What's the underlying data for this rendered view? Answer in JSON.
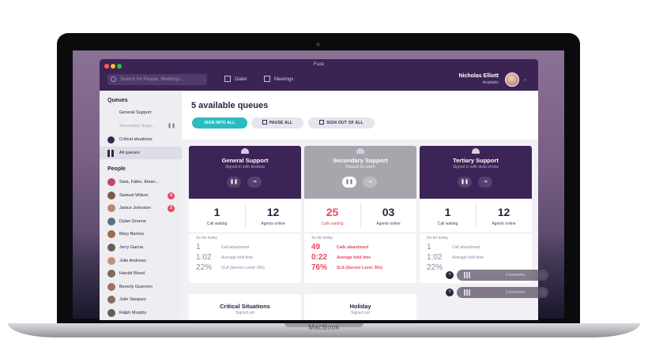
{
  "app": {
    "title": "Fuze",
    "device_label": "MacBook"
  },
  "topbar": {
    "search_placeholder": "Search for People, Meetings...",
    "nav": [
      {
        "label": "Dialer",
        "icon": "dialpad-icon"
      },
      {
        "label": "Meetings",
        "icon": "calendar-icon"
      }
    ],
    "user": {
      "name": "Nicholas Elliott",
      "status": "Available"
    }
  },
  "sidebar": {
    "queues_title": "Queues",
    "queues": [
      {
        "label": "General Support"
      },
      {
        "label": "Secondary Supp..."
      },
      {
        "label": "Critical situations",
        "icon": "alert-icon"
      },
      {
        "label": "All queues",
        "icon": "grid-icon"
      }
    ],
    "people_title": "People",
    "people": [
      {
        "label": "Sara, Fábio, Elean...",
        "color": "#b84a6b"
      },
      {
        "label": "Samuel Wilson",
        "badge": "4",
        "color": "#7b5a4a"
      },
      {
        "label": "Janice Johnston",
        "badge": "2",
        "color": "#c2866a"
      },
      {
        "label": "Dylan Greene",
        "color": "#5b6f82"
      },
      {
        "label": "Mary Barnes",
        "color": "#9a6b55"
      },
      {
        "label": "Jerry Garcia",
        "color": "#6d5c4f"
      },
      {
        "label": "Julie Andrews",
        "color": "#c59076"
      },
      {
        "label": "Harold Wood",
        "color": "#7d6a5d"
      },
      {
        "label": "Beverly Guerrero",
        "color": "#a66e5a"
      },
      {
        "label": "Julie Vasquez",
        "color": "#8b6b59"
      },
      {
        "label": "Ralph Murphy",
        "color": "#6a5a52"
      }
    ]
  },
  "main": {
    "title": "5 available queues",
    "actions": {
      "sign_in": "SIGN INTO ALL",
      "pause": "PAUSE ALL",
      "sign_out": "SIGN OUT OF ALL"
    },
    "cards": [
      {
        "name": "General Support",
        "status": "Signed in with desktop",
        "calls_waiting": "1",
        "calls_waiting_label": "Call waiting",
        "agents_online": "12",
        "agents_online_label": "Agents online",
        "so_far": "So far today",
        "stats": [
          {
            "value": "1",
            "label": "Call abandoned"
          },
          {
            "value": "1:02",
            "label": "Average hold time"
          },
          {
            "value": "22%",
            "label": "SLA (Service Level: 90s)"
          }
        ]
      },
      {
        "name": "Secondary Support",
        "status": "Paused for lunch",
        "calls_waiting": "25",
        "calls_waiting_label": "Calls waiting",
        "agents_online": "03",
        "agents_online_label": "Agents online",
        "so_far": "So far today",
        "stats": [
          {
            "value": "49",
            "label": "Calls abandoned"
          },
          {
            "value": "0:22",
            "label": "Average hold time"
          },
          {
            "value": "76%",
            "label": "SLA (Service Level: 90s)"
          }
        ]
      },
      {
        "name": "Tertiary Support",
        "status": "Signed in with desk phone",
        "calls_waiting": "1",
        "calls_waiting_label": "Call waiting",
        "agents_online": "12",
        "agents_online_label": "Agents online",
        "so_far": "So far today",
        "stats": [
          {
            "value": "1",
            "label": "Call abandoned"
          },
          {
            "value": "1:02",
            "label": "Average hold time"
          },
          {
            "value": "22%",
            "label": ""
          }
        ]
      }
    ],
    "lower_cards": [
      {
        "name": "Critical Situations",
        "status": "Signed out"
      },
      {
        "name": "Holiday",
        "status": "Signed out"
      }
    ],
    "overlay_comments": [
      {
        "label": "Comments"
      },
      {
        "label": "Comments"
      }
    ]
  },
  "colors": {
    "brand": "#3b2353",
    "accent": "#2bbcc1",
    "alert": "#e8475f",
    "paused": "#a8a5ad"
  }
}
